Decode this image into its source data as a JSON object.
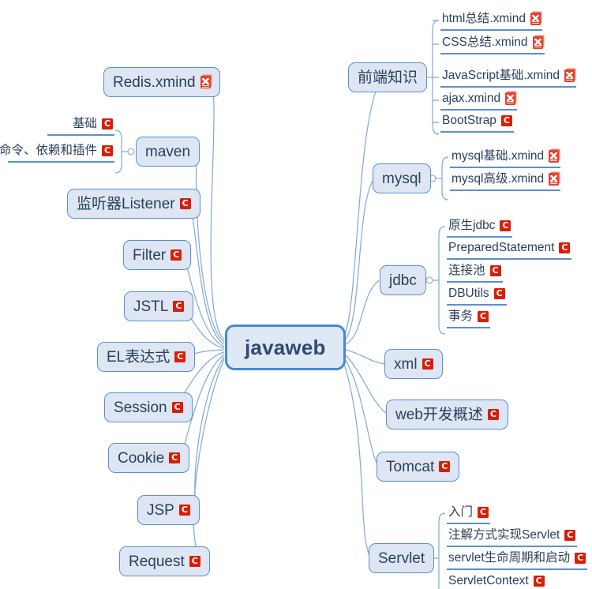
{
  "colors": {
    "node_fill": "#dde6f2",
    "node_border": "#5b8fd1",
    "root_fill": "#dfe8f5",
    "root_border": "#4a87d3",
    "text": "#2b3f5c",
    "root_text": "#2e4a73",
    "wire": "#7fa8d8",
    "csdn_icon": "#d81e06",
    "xmind_icon": "#e8422e",
    "background": "#ffffff"
  },
  "root": {
    "label": "javaweb"
  },
  "icons": {
    "csdn": "csdn-c-icon",
    "xmind": "xmind-file-icon",
    "collapse": "collapse-toggle-icon"
  },
  "branches": {
    "frontend": {
      "label": "前端知识",
      "children": [
        {
          "label": "html总结.xmind",
          "icon": "xmind"
        },
        {
          "label": "CSS总结.xmind",
          "icon": "xmind"
        },
        {
          "label": "JavaScript基础.xmind",
          "icon": "xmind"
        },
        {
          "label": "ajax.xmind",
          "icon": "xmind"
        },
        {
          "label": "BootStrap",
          "icon": "csdn"
        }
      ]
    },
    "mysql": {
      "label": "mysql",
      "children": [
        {
          "label": "mysql基础.xmind",
          "icon": "xmind"
        },
        {
          "label": "mysql高级.xmind",
          "icon": "xmind"
        }
      ]
    },
    "jdbc": {
      "label": "jdbc",
      "children": [
        {
          "label": "原生jdbc",
          "icon": "csdn"
        },
        {
          "label": "PreparedStatement",
          "icon": "csdn"
        },
        {
          "label": "连接池",
          "icon": "csdn"
        },
        {
          "label": "DBUtils",
          "icon": "csdn"
        },
        {
          "label": "事务",
          "icon": "csdn"
        }
      ]
    },
    "xml": {
      "label": "xml",
      "icon": "csdn",
      "children": []
    },
    "webdev": {
      "label": "web开发概述",
      "icon": "csdn",
      "children": []
    },
    "tomcat": {
      "label": "Tomcat",
      "icon": "csdn",
      "children": []
    },
    "servlet": {
      "label": "Servlet",
      "children": [
        {
          "label": "入门",
          "icon": "csdn"
        },
        {
          "label": "注解方式实现Servlet",
          "icon": "csdn"
        },
        {
          "label": "servlet生命周期和启动",
          "icon": "csdn"
        },
        {
          "label": "ServletContext",
          "icon": "csdn"
        }
      ]
    },
    "redis": {
      "label": "Redis.xmind",
      "icon": "xmind",
      "children": []
    },
    "maven": {
      "label": "maven",
      "children": [
        {
          "label": "基础",
          "icon": "csdn"
        },
        {
          "label": "命令、依赖和插件",
          "icon": "csdn"
        }
      ]
    },
    "listener": {
      "label": "监听器Listener",
      "icon": "csdn",
      "children": []
    },
    "filter": {
      "label": "Filter",
      "icon": "csdn",
      "children": []
    },
    "jstl": {
      "label": "JSTL",
      "icon": "csdn",
      "children": []
    },
    "el": {
      "label": "EL表达式",
      "icon": "csdn",
      "children": []
    },
    "session": {
      "label": "Session",
      "icon": "csdn",
      "children": []
    },
    "cookie": {
      "label": "Cookie",
      "icon": "csdn",
      "children": []
    },
    "jsp": {
      "label": "JSP",
      "icon": "csdn",
      "children": []
    },
    "request": {
      "label": "Request",
      "icon": "csdn",
      "children": []
    }
  }
}
